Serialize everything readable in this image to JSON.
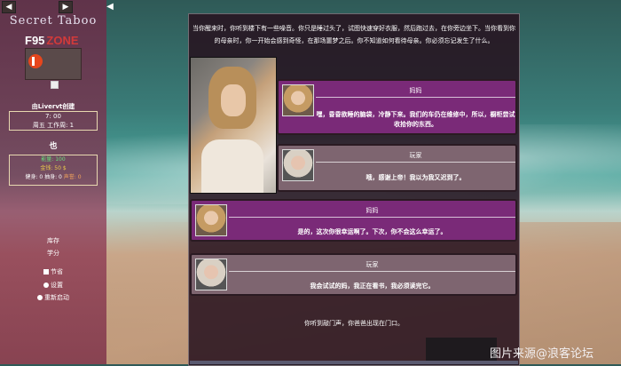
{
  "story_title": "Secret Taboo",
  "f95": {
    "f95": "F95",
    "zone": "ZONE"
  },
  "sidebar": {
    "created_by": "由Livervt创建",
    "time": "7: 00",
    "day": "周五 工作周: 1",
    "character_name": "也",
    "stats": {
      "energy": "能量: 100",
      "money": "金钱: 50 $",
      "row3": [
        "健身: 0",
        "抽身: 0",
        "声誉: 0"
      ]
    },
    "menu": {
      "inventory": "库存",
      "skills": "学分",
      "save": "节省",
      "settings": "设置",
      "restart": "重新启动"
    }
  },
  "story": {
    "intro": [
      "当你醒来时，你听到楼下有一些噪音。你只是睡过头了，试图快速穿好衣服，然后跑过去，在你旁边坐下。当你看到你",
      "的母亲时，你一开始会感到奇怪，在那场噩梦之后。你不知道如何看待母亲。你必须忘记发生了什么。"
    ],
    "dialogues": [
      {
        "speaker": "妈妈",
        "lines": [
          "嘿，昏昏欲睡的脑袋，冷静下来。我们的车仍在维修中，所以，橱柜尝试",
          "收拾你的东西。"
        ]
      },
      {
        "speaker": "玩家",
        "lines": [
          "哦，感谢上帝！我以为我又迟到了。"
        ]
      },
      {
        "speaker": "妈妈",
        "lines": [
          "是的，这次你很幸运啊了。下次，你不会这么幸运了。"
        ]
      },
      {
        "speaker": "玩家",
        "lines": [
          "我会试试的妈，我正在看书，我必须读完它。"
        ]
      }
    ],
    "outro": "你听到敲门声，你爸爸出现在门口。"
  },
  "watermark": "图片来源@浪客论坛"
}
